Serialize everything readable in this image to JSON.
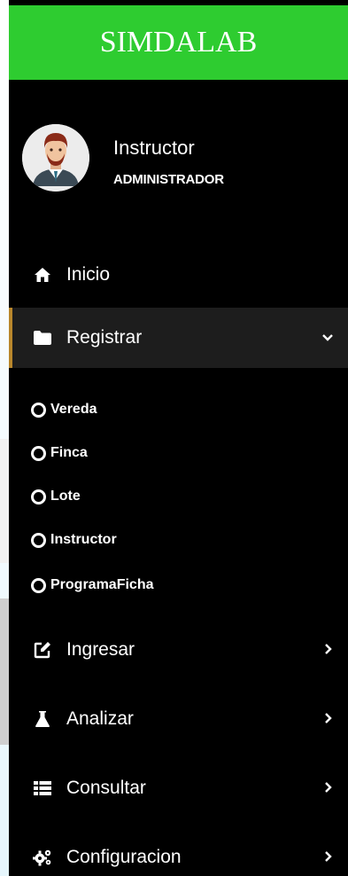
{
  "brand": "SIMDALAB",
  "user": {
    "name": "Instructor",
    "role": "ADMINISTRADOR"
  },
  "nav": {
    "inicio": {
      "label": "Inicio",
      "icon": "home-icon"
    },
    "registrar": {
      "label": "Registrar",
      "icon": "folder-icon",
      "expanded": true,
      "submenu": [
        "Vereda",
        "Finca",
        "Lote",
        "Instructor",
        "ProgramaFicha"
      ]
    },
    "ingresar": {
      "label": "Ingresar",
      "icon": "edit-icon"
    },
    "analizar": {
      "label": "Analizar",
      "icon": "flask-icon"
    },
    "consultar": {
      "label": "Consultar",
      "icon": "list-icon"
    },
    "configuracion": {
      "label": "Configuracion",
      "icon": "cogs-icon"
    }
  },
  "colors": {
    "brand_bg": "#2ecc30",
    "sidebar_bg": "#000000",
    "active_bg": "#1d1d1d",
    "active_border": "#b8862b"
  }
}
